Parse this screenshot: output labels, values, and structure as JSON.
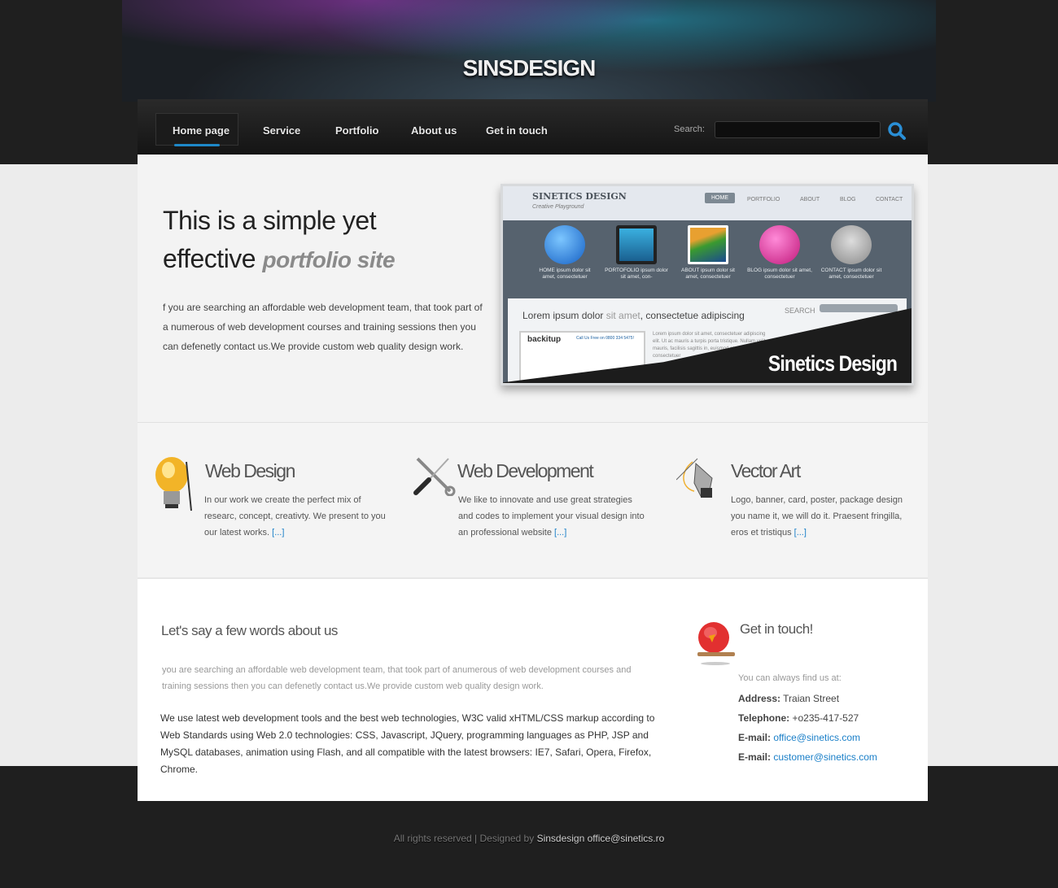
{
  "site": {
    "logo": "SINSDESIGN"
  },
  "nav": {
    "items": [
      {
        "label": "Home page",
        "active": true
      },
      {
        "label": "Service"
      },
      {
        "label": "Portfolio"
      },
      {
        "label": "About us"
      },
      {
        "label": "Get in touch"
      }
    ],
    "search_label": "Search:",
    "search_value": "",
    "accent": "#1e88c8"
  },
  "hero": {
    "title_line1": "This is a simple  yet",
    "title_line2": "effective ",
    "title_em": "portfolio site",
    "text": "f you are searching an affordable web development team, that took part of a numerous of web development courses and training sessions then you can defenetly contact us.We provide custom web quality design work.",
    "preview": {
      "logo": "SINETICS DESIGN",
      "tagline": "Creative Playground",
      "menu": [
        "HOME",
        "PORTFOLIO",
        "ABOUT",
        "BLOG",
        "CONTACT"
      ],
      "items": [
        "HOME ipsum dolor sit amet, consectetuer",
        "PORTOFOLIO ipsum dolor sit amet, con-",
        "ABOUT ipsum dolor sit amet, consectetuer",
        "BLOG ipsum dolor sit amet, consectetuer",
        "CONTACT ipsum dolor sit amet, consectetuer"
      ],
      "heading": "Lorem ipsum dolor ",
      "heading_light": "sit amet",
      "heading_end": ", consectetue adipiscing",
      "search": "SEARCH",
      "shot_logo": "backitup",
      "shot_call": "Call Us Free on 0800 334 5475!",
      "lorem": "Lorem ipsum dolor sit amet, consectetuer adipiscing elit. Ut ac mauris a turpis porta tristique. Nullam velit mauris, facilisis sagittis in, euismod et ... feugiat consectetuer",
      "brand": "Sinetics Design"
    }
  },
  "services": [
    {
      "icon": "lightbulb-icon",
      "title": "Web Design",
      "text": "In our work we  create the perfect mix of researc, concept, creativty. We present to you our latest works.  ",
      "more": "[...]"
    },
    {
      "icon": "tools-icon",
      "title": "Web Development",
      "text": " We like to innovate and use  great strategies and codes to implement your visual design into an professional website ",
      "more": "[...]"
    },
    {
      "icon": "pen-nib-icon",
      "title": "Vector Art",
      "text": "Logo, banner, card, poster, package design you name it, we will do it.  Praesent fringilla, eros et tristiqus ",
      "more": "[...]"
    }
  ],
  "about": {
    "title": "Let's say a few words about us",
    "lead": "you are searching an affordable web development team, that took part of anumerous of web development courses and training sessions then you can defenetly contact us.We provide custom web quality design work.",
    "text": "We use latest web development tools and the best web technologies, W3C valid xHTML/CSS markup according to Web Standards using Web 2.0 technologies: CSS, Javascript, JQuery, programming languages as PHP, JSP and MySQL databases, animation using Flash, and all compatible with the latest browsers: IE7, Safari, Opera, Firefox, Chrome."
  },
  "contact": {
    "title": "Get in touch!",
    "intro": "You can always find us at:",
    "address_label": "Address:",
    "address": "Traian Street",
    "phone_label": "Telephone:",
    "phone": "+o235-417-527",
    "email_label": "E-mail:",
    "email1": "office@sinetics.com",
    "email2": "customer@sinetics.com"
  },
  "footer": {
    "text": "All rights reserved | Designed by ",
    "designer": "Sinsdesign",
    "email": "office@sinetics.ro"
  }
}
